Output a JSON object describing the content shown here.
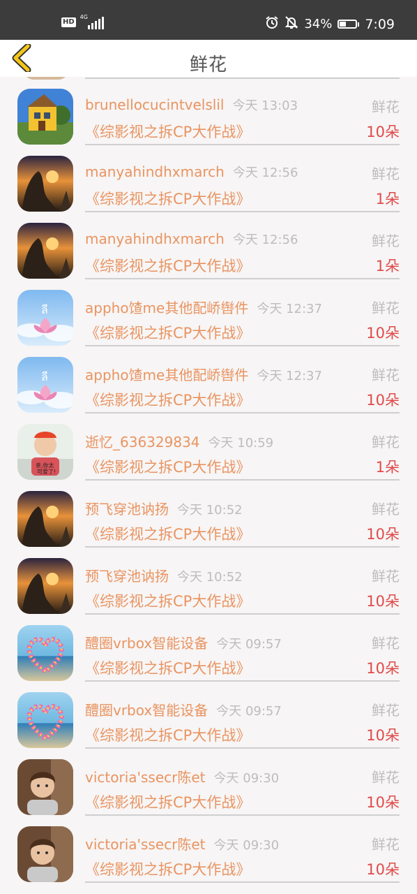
{
  "status_bar": {
    "hd": "HD",
    "network": "4G",
    "battery": "34%",
    "time": "7:09"
  },
  "header": {
    "title": "鲜花",
    "back_icon": "chevron-left-icon",
    "accent_color": "#f5c518"
  },
  "colors": {
    "name": "#e99461",
    "meta": "#bdbdbd",
    "count": "#e04a4a",
    "background": "#f7f5f5"
  },
  "items": [
    {
      "user": "brunellocucintvelslil",
      "time": "今天 13:03",
      "gift": "鲜花",
      "show": "《综影视之拆CP大作战》",
      "count": "10朵",
      "avatar": "house"
    },
    {
      "user": "manyahindhxmarch",
      "time": "今天 12:56",
      "gift": "鲜花",
      "show": "《综影视之拆CP大作战》",
      "count": "1朵",
      "avatar": "sunset"
    },
    {
      "user": "manyahindhxmarch",
      "time": "今天 12:56",
      "gift": "鲜花",
      "show": "《综影视之拆CP大作战》",
      "count": "1朵",
      "avatar": "sunset"
    },
    {
      "user": "appho馇me其他配峤辔件",
      "time": "今天 12:37",
      "gift": "鲜花",
      "show": "《综影视之拆CP大作战》",
      "count": "10朵",
      "avatar": "lotus"
    },
    {
      "user": "appho馇me其他配峤辔件",
      "time": "今天 12:37",
      "gift": "鲜花",
      "show": "《综影视之拆CP大作战》",
      "count": "10朵",
      "avatar": "lotus"
    },
    {
      "user": "逝忆_636329834",
      "time": "今天 10:59",
      "gift": "鲜花",
      "show": "《综影视之拆CP大作战》",
      "count": "1朵",
      "avatar": "kid"
    },
    {
      "user": "预飞穿池讷扬",
      "time": "今天 10:52",
      "gift": "鲜花",
      "show": "《综影视之拆CP大作战》",
      "count": "10朵",
      "avatar": "sunset"
    },
    {
      "user": "预飞穿池讷扬",
      "time": "今天 10:52",
      "gift": "鲜花",
      "show": "《综影视之拆CP大作战》",
      "count": "10朵",
      "avatar": "sunset"
    },
    {
      "user": "醴圈vrbox智能设备",
      "time": "今天 09:57",
      "gift": "鲜花",
      "show": "《综影视之拆CP大作战》",
      "count": "10朵",
      "avatar": "heart"
    },
    {
      "user": "醴圈vrbox智能设备",
      "time": "今天 09:57",
      "gift": "鲜花",
      "show": "《综影视之拆CP大作战》",
      "count": "10朵",
      "avatar": "heart"
    },
    {
      "user": "victoria'ssecr陈et",
      "time": "今天 09:30",
      "gift": "鲜花",
      "show": "《综影视之拆CP大作战》",
      "count": "10朵",
      "avatar": "boy"
    },
    {
      "user": "victoria'ssecr陈et",
      "time": "今天 09:30",
      "gift": "鲜花",
      "show": "《综影视之拆CP大作战》",
      "count": "10朵",
      "avatar": "boy"
    }
  ]
}
